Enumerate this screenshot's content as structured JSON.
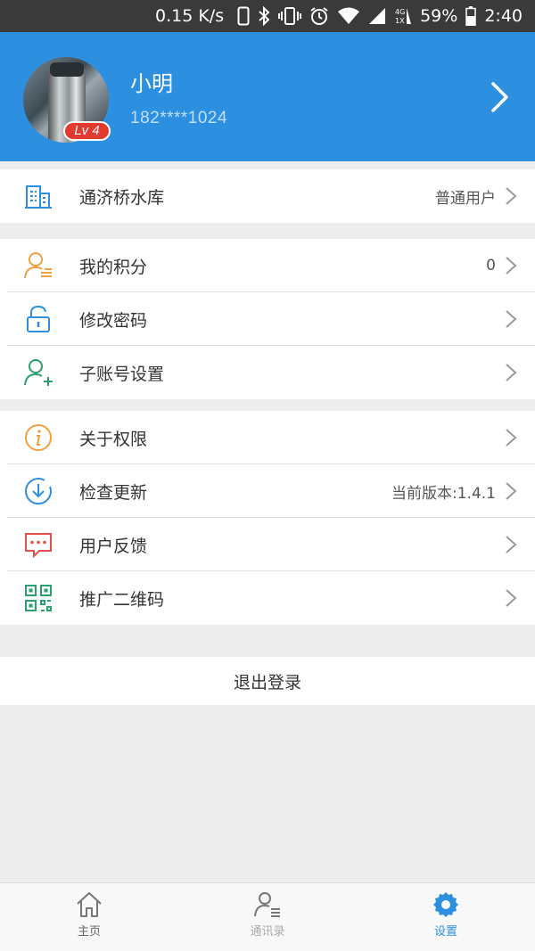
{
  "status_bar": {
    "net_speed": "0.15 K/s",
    "battery": "59%",
    "time": "2:40",
    "icons": [
      "phone-icon",
      "bluetooth-icon",
      "vibrate-icon",
      "alarm-icon",
      "wifi-icon",
      "signal-icon",
      "data-4g-icon",
      "battery-icon"
    ]
  },
  "profile": {
    "name": "小明",
    "phone": "182****1024",
    "level": "Lv 4",
    "accent_color": "#2d8fe0",
    "badge_color": "#e23a2e"
  },
  "org_row": {
    "label": "通济桥水库",
    "value": "普通用户",
    "icon": "building-icon"
  },
  "group1": [
    {
      "label": "我的积分",
      "value": "0",
      "icon": "user-points-icon"
    },
    {
      "label": "修改密码",
      "value": "",
      "icon": "lock-icon"
    },
    {
      "label": "子账号设置",
      "value": "",
      "icon": "add-user-icon"
    }
  ],
  "group2": [
    {
      "label": "关于权限",
      "value": "",
      "icon": "info-icon"
    },
    {
      "label": "检查更新",
      "value": "当前版本:1.4.1",
      "icon": "download-icon"
    },
    {
      "label": "用户反馈",
      "value": "",
      "icon": "chat-icon"
    },
    {
      "label": "推广二维码",
      "value": "",
      "icon": "qr-code-icon"
    }
  ],
  "logout": {
    "label": "退出登录"
  },
  "tabbar": {
    "tabs": [
      {
        "label": "主页",
        "icon": "home-icon",
        "active": false
      },
      {
        "label": "通讯录",
        "icon": "contacts-icon",
        "active": false
      },
      {
        "label": "设置",
        "icon": "gear-icon",
        "active": true
      }
    ]
  }
}
